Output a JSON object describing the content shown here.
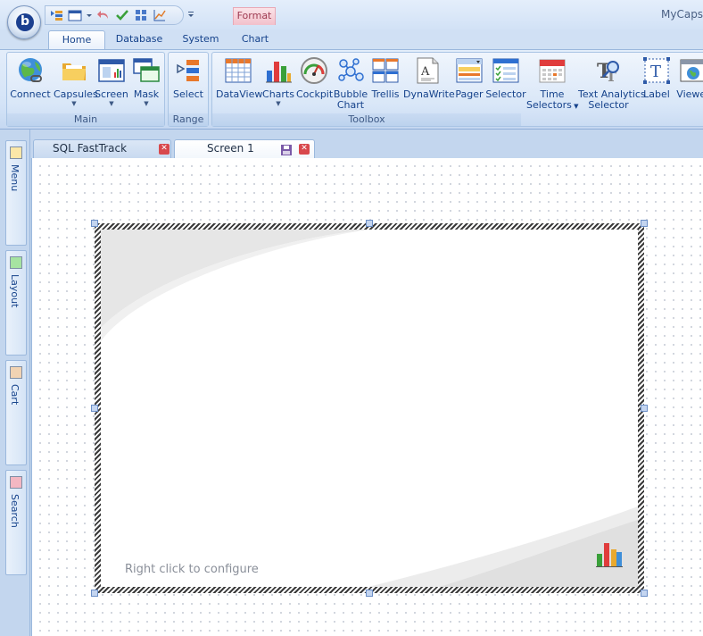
{
  "app": {
    "title": "MyCapsu"
  },
  "context_tab": {
    "label": "Format"
  },
  "ribbon_tabs": [
    {
      "label": "Home",
      "active": true
    },
    {
      "label": "Database"
    },
    {
      "label": "System"
    },
    {
      "label": "Chart"
    }
  ],
  "groups": {
    "main": {
      "label": "Main",
      "buttons": [
        {
          "label": "Connect",
          "icon": "globe-icon"
        },
        {
          "label": "Capsules",
          "icon": "folder-icon",
          "dropdown": true
        },
        {
          "label": "Screen",
          "icon": "screen-icon",
          "dropdown": true
        },
        {
          "label": "Mask",
          "icon": "windows-icon",
          "dropdown": true
        }
      ]
    },
    "range": {
      "label": "Range",
      "buttons": [
        {
          "label": "Select",
          "icon": "range-select-icon"
        }
      ]
    },
    "toolbox": {
      "label": "Toolbox",
      "buttons": [
        {
          "label": "DataView",
          "icon": "grid-icon"
        },
        {
          "label": "Charts",
          "icon": "bar-chart-icon",
          "dropdown": true
        },
        {
          "label": "Cockpit",
          "icon": "gauge-icon"
        },
        {
          "label_line1": "Bubble",
          "label_line2": "Chart",
          "icon": "bubble-chart-icon"
        },
        {
          "label": "Trellis",
          "icon": "trellis-icon"
        },
        {
          "label": "DynaWrite",
          "icon": "document-icon"
        },
        {
          "label": "Pager",
          "icon": "pager-icon"
        },
        {
          "label": "Selector",
          "icon": "selector-icon"
        },
        {
          "label_line1": "Time",
          "label_line2": "Selectors",
          "icon": "calendar-icon",
          "dropdown": true
        },
        {
          "label_line1": "Text Analytics",
          "label_line2": "Selector",
          "icon": "text-analytics-icon"
        },
        {
          "label": "Label",
          "icon": "label-icon"
        },
        {
          "label": "Viewer",
          "icon": "viewer-icon"
        }
      ]
    }
  },
  "side_tabs": [
    {
      "label": "Menu",
      "color": "#fbe7a8"
    },
    {
      "label": "Layout",
      "color": "#a6e3a1"
    },
    {
      "label": "Cart",
      "color": "#f1d3b3"
    },
    {
      "label": "Search",
      "color": "#f3b7c2"
    }
  ],
  "doc_tabs": [
    {
      "label": "SQL FastTrack",
      "active": false
    },
    {
      "label": "Screen 1",
      "active": true
    }
  ],
  "widget": {
    "hint": "Right click to configure"
  },
  "colors": {
    "accent": "#15428b",
    "ribbon": "#d3e3f7",
    "close": "#d8484c"
  }
}
